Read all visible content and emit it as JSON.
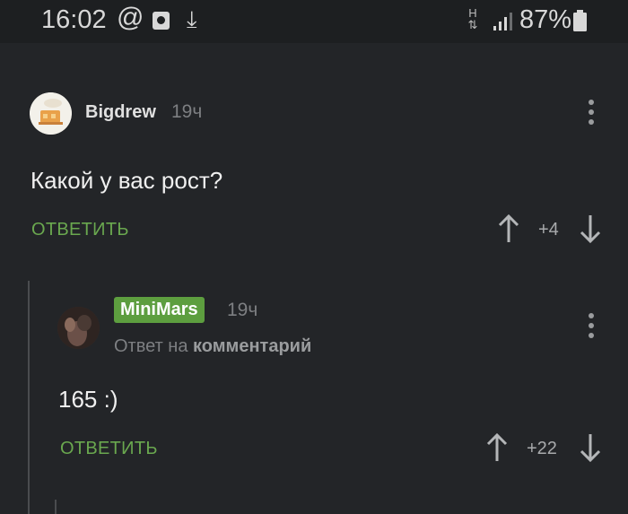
{
  "status_bar": {
    "time": "16:02",
    "at_symbol": "@",
    "download_glyph": "⤓",
    "network_label": "H",
    "battery_percent": "87%"
  },
  "comments": [
    {
      "author": "Bigdrew",
      "time": "19ч",
      "text": "Какой у вас рост?",
      "reply_label": "ОТВЕТИТЬ",
      "score": "+4"
    },
    {
      "author": "MiniMars",
      "time": "19ч",
      "reply_to_prefix": "Ответ на",
      "reply_to_target": "комментарий",
      "text": "165 :)",
      "reply_label": "ОТВЕТИТЬ",
      "score": "+22"
    }
  ],
  "colors": {
    "background": "#232528",
    "accent_green": "#6aa84f",
    "badge_green": "#5d9e3f"
  }
}
